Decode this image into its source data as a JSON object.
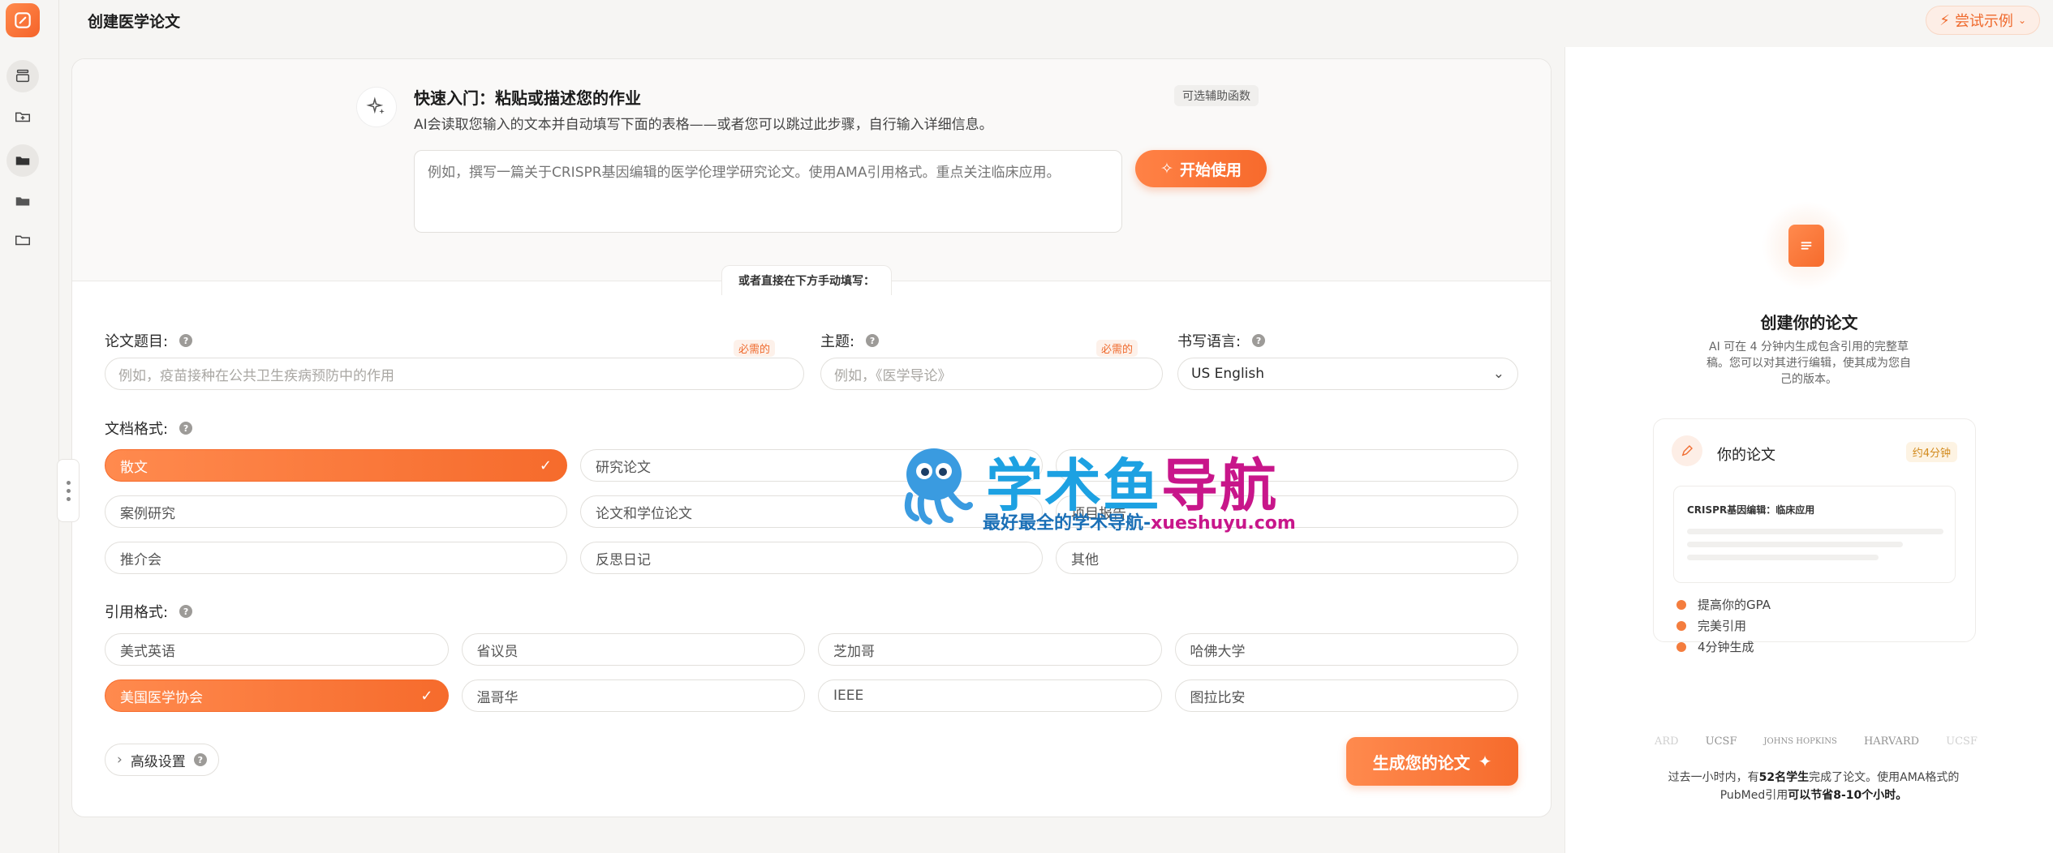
{
  "header": {
    "title": "创建医学论文",
    "try_label": "尝试示例"
  },
  "quick_start": {
    "title": "快速入门：粘贴或描述您的作业",
    "description": "AI会读取您输入的文本并自动填写下面的表格——或者您可以跳过此步骤，自行输入详细信息。",
    "optional_label": "可选辅助函数",
    "placeholder": "例如，撰写一篇关于CRISPR基因编辑的医学伦理学研究论文。使用AMA引用格式。重点关注临床应用。",
    "start_label": "开始使用"
  },
  "divider_label": "或者直接在下方手动填写：",
  "form": {
    "title_label": "论文题目:",
    "title_placeholder": "例如，疫苗接种在公共卫生疾病预防中的作用",
    "required_label": "必需的",
    "subject_label": "主题:",
    "subject_placeholder": "例如，《医学导论》",
    "language_label": "书写语言:",
    "language_value": "US English",
    "format_label": "文档格式:",
    "formats": [
      {
        "label": "散文",
        "selected": true
      },
      {
        "label": "研究论文",
        "selected": false
      },
      {
        "label": "",
        "selected": false
      },
      {
        "label": "案例研究",
        "selected": false
      },
      {
        "label": "论文和学位论文",
        "selected": false
      },
      {
        "label": "项目报告",
        "selected": false
      },
      {
        "label": "推介会",
        "selected": false
      },
      {
        "label": "反思日记",
        "selected": false
      },
      {
        "label": "其他",
        "selected": false
      }
    ],
    "citation_label": "引用格式:",
    "citations": [
      {
        "label": "美式英语",
        "selected": false
      },
      {
        "label": "省议员",
        "selected": false
      },
      {
        "label": "芝加哥",
        "selected": false
      },
      {
        "label": "哈佛大学",
        "selected": false
      },
      {
        "label": "美国医学协会",
        "selected": true
      },
      {
        "label": "温哥华",
        "selected": false
      },
      {
        "label": "IEEE",
        "selected": false
      },
      {
        "label": "图拉比安",
        "selected": false
      }
    ],
    "advanced_label": "高级设置",
    "generate_label": "生成您的论文"
  },
  "watermark": {
    "title_a": "学术鱼",
    "title_b": "导航",
    "sub_a": "最好最全的学术导航-",
    "sub_b": "xueshuyu.com"
  },
  "right_panel": {
    "title": "创建你的论文",
    "description": "AI 可在 4 分钟内生成包含引用的完整草稿。您可以对其进行编辑，使其成为您自己的版本。",
    "preview_title": "你的论文",
    "time_tag": "约4分钟",
    "mini_title": "CRISPR基因编辑：临床应用",
    "features": [
      "提高你的GPA",
      "完美引用",
      "4分钟生成"
    ],
    "logos": [
      "ARD",
      "UCSF",
      "JOHNS HOPKINS",
      "HARVARD",
      "UCSF"
    ],
    "note_prefix": "过去一小时内，有",
    "note_count": "52名学生",
    "note_mid": "完成了论文。使用AMA格式的PubMed引用",
    "note_save": "可以节省8-10个小时。"
  },
  "colors": {
    "accent": "#f66b2c",
    "accent_light": "#ff8a4e"
  }
}
